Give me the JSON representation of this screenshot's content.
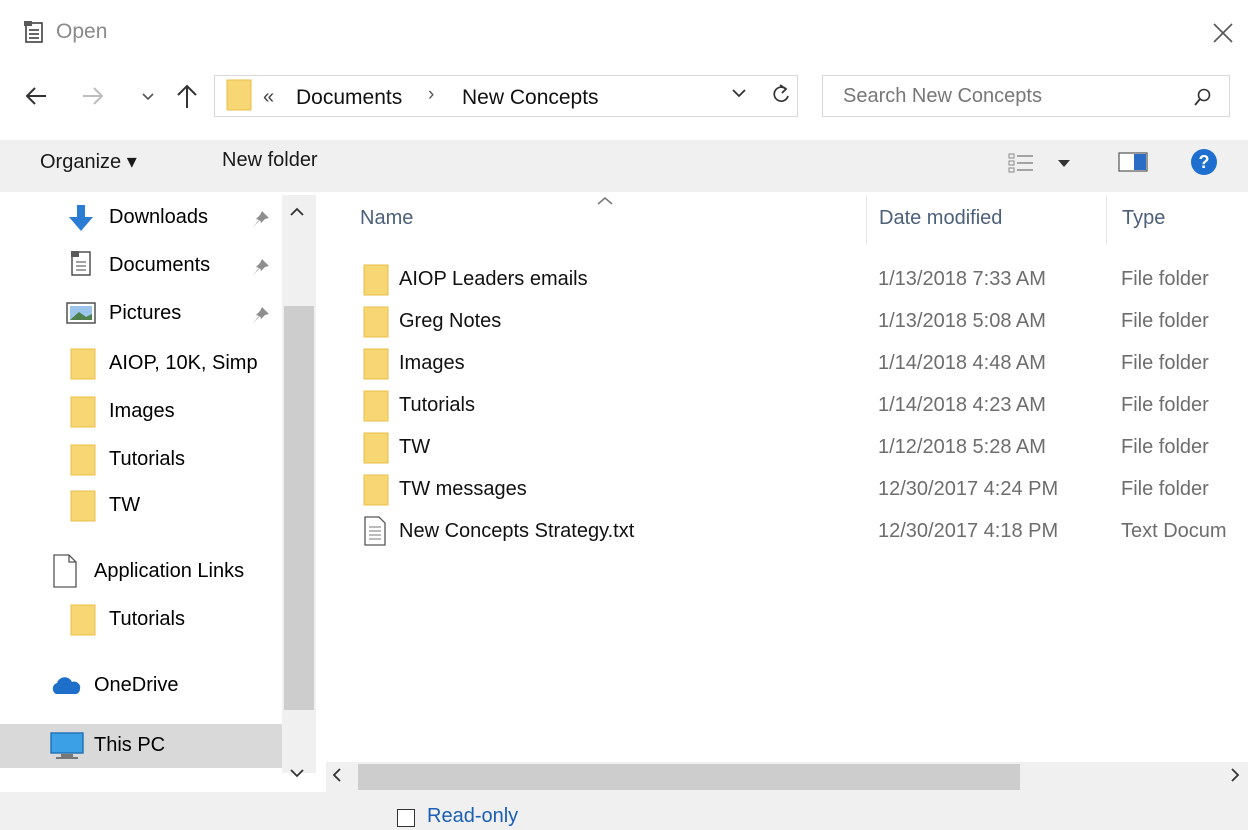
{
  "window": {
    "title": "Open"
  },
  "address": {
    "chevron": "«",
    "segments": [
      "Documents",
      "New Concepts"
    ],
    "separator": "›"
  },
  "search": {
    "placeholder": "Search New Concepts"
  },
  "toolbar": {
    "organize_label": "Organize ▾",
    "new_folder_label": "New folder"
  },
  "sidebar": {
    "items": [
      {
        "label": "Downloads",
        "icon": "download-arrow-icon",
        "pinned": true
      },
      {
        "label": "Documents",
        "icon": "documents-icon",
        "pinned": true
      },
      {
        "label": "Pictures",
        "icon": "pictures-icon",
        "pinned": true
      },
      {
        "label": "AIOP, 10K, Simp",
        "icon": "folder-icon",
        "pinned": false
      },
      {
        "label": "Images",
        "icon": "folder-icon",
        "pinned": false
      },
      {
        "label": "Tutorials",
        "icon": "folder-icon",
        "pinned": false
      },
      {
        "label": "TW",
        "icon": "folder-icon",
        "pinned": false
      },
      {
        "label": "Application Links",
        "icon": "blank-page-icon",
        "pinned": false
      },
      {
        "label": "Tutorials",
        "icon": "folder-icon",
        "pinned": false
      },
      {
        "label": "OneDrive",
        "icon": "onedrive-cloud-icon",
        "pinned": false
      },
      {
        "label": "This PC",
        "icon": "this-pc-monitor-icon",
        "pinned": false,
        "selected": true
      }
    ]
  },
  "columns": {
    "name": "Name",
    "date": "Date modified",
    "type": "Type"
  },
  "files": [
    {
      "name": "AIOP Leaders emails",
      "date": "1/13/2018 7:33 AM",
      "type": "File folder",
      "kind": "folder"
    },
    {
      "name": "Greg Notes",
      "date": "1/13/2018 5:08 AM",
      "type": "File folder",
      "kind": "folder"
    },
    {
      "name": "Images",
      "date": "1/14/2018 4:48 AM",
      "type": "File folder",
      "kind": "folder"
    },
    {
      "name": "Tutorials",
      "date": "1/14/2018 4:23 AM",
      "type": "File folder",
      "kind": "folder"
    },
    {
      "name": "TW",
      "date": "1/12/2018 5:28 AM",
      "type": "File folder",
      "kind": "folder"
    },
    {
      "name": "TW messages",
      "date": "12/30/2017 4:24 PM",
      "type": "File folder",
      "kind": "folder"
    },
    {
      "name": "New Concepts Strategy.txt",
      "date": "12/30/2017 4:18 PM",
      "type": "Text Docum",
      "kind": "text"
    }
  ],
  "readonly": {
    "label": "Read-only",
    "checked": false
  },
  "colors": {
    "folder": "#f7d774",
    "folder_dark": "#e8be4a",
    "accent": "#1a5fb4",
    "help": "#1f6fd1",
    "selection": "#d9d9d9"
  }
}
